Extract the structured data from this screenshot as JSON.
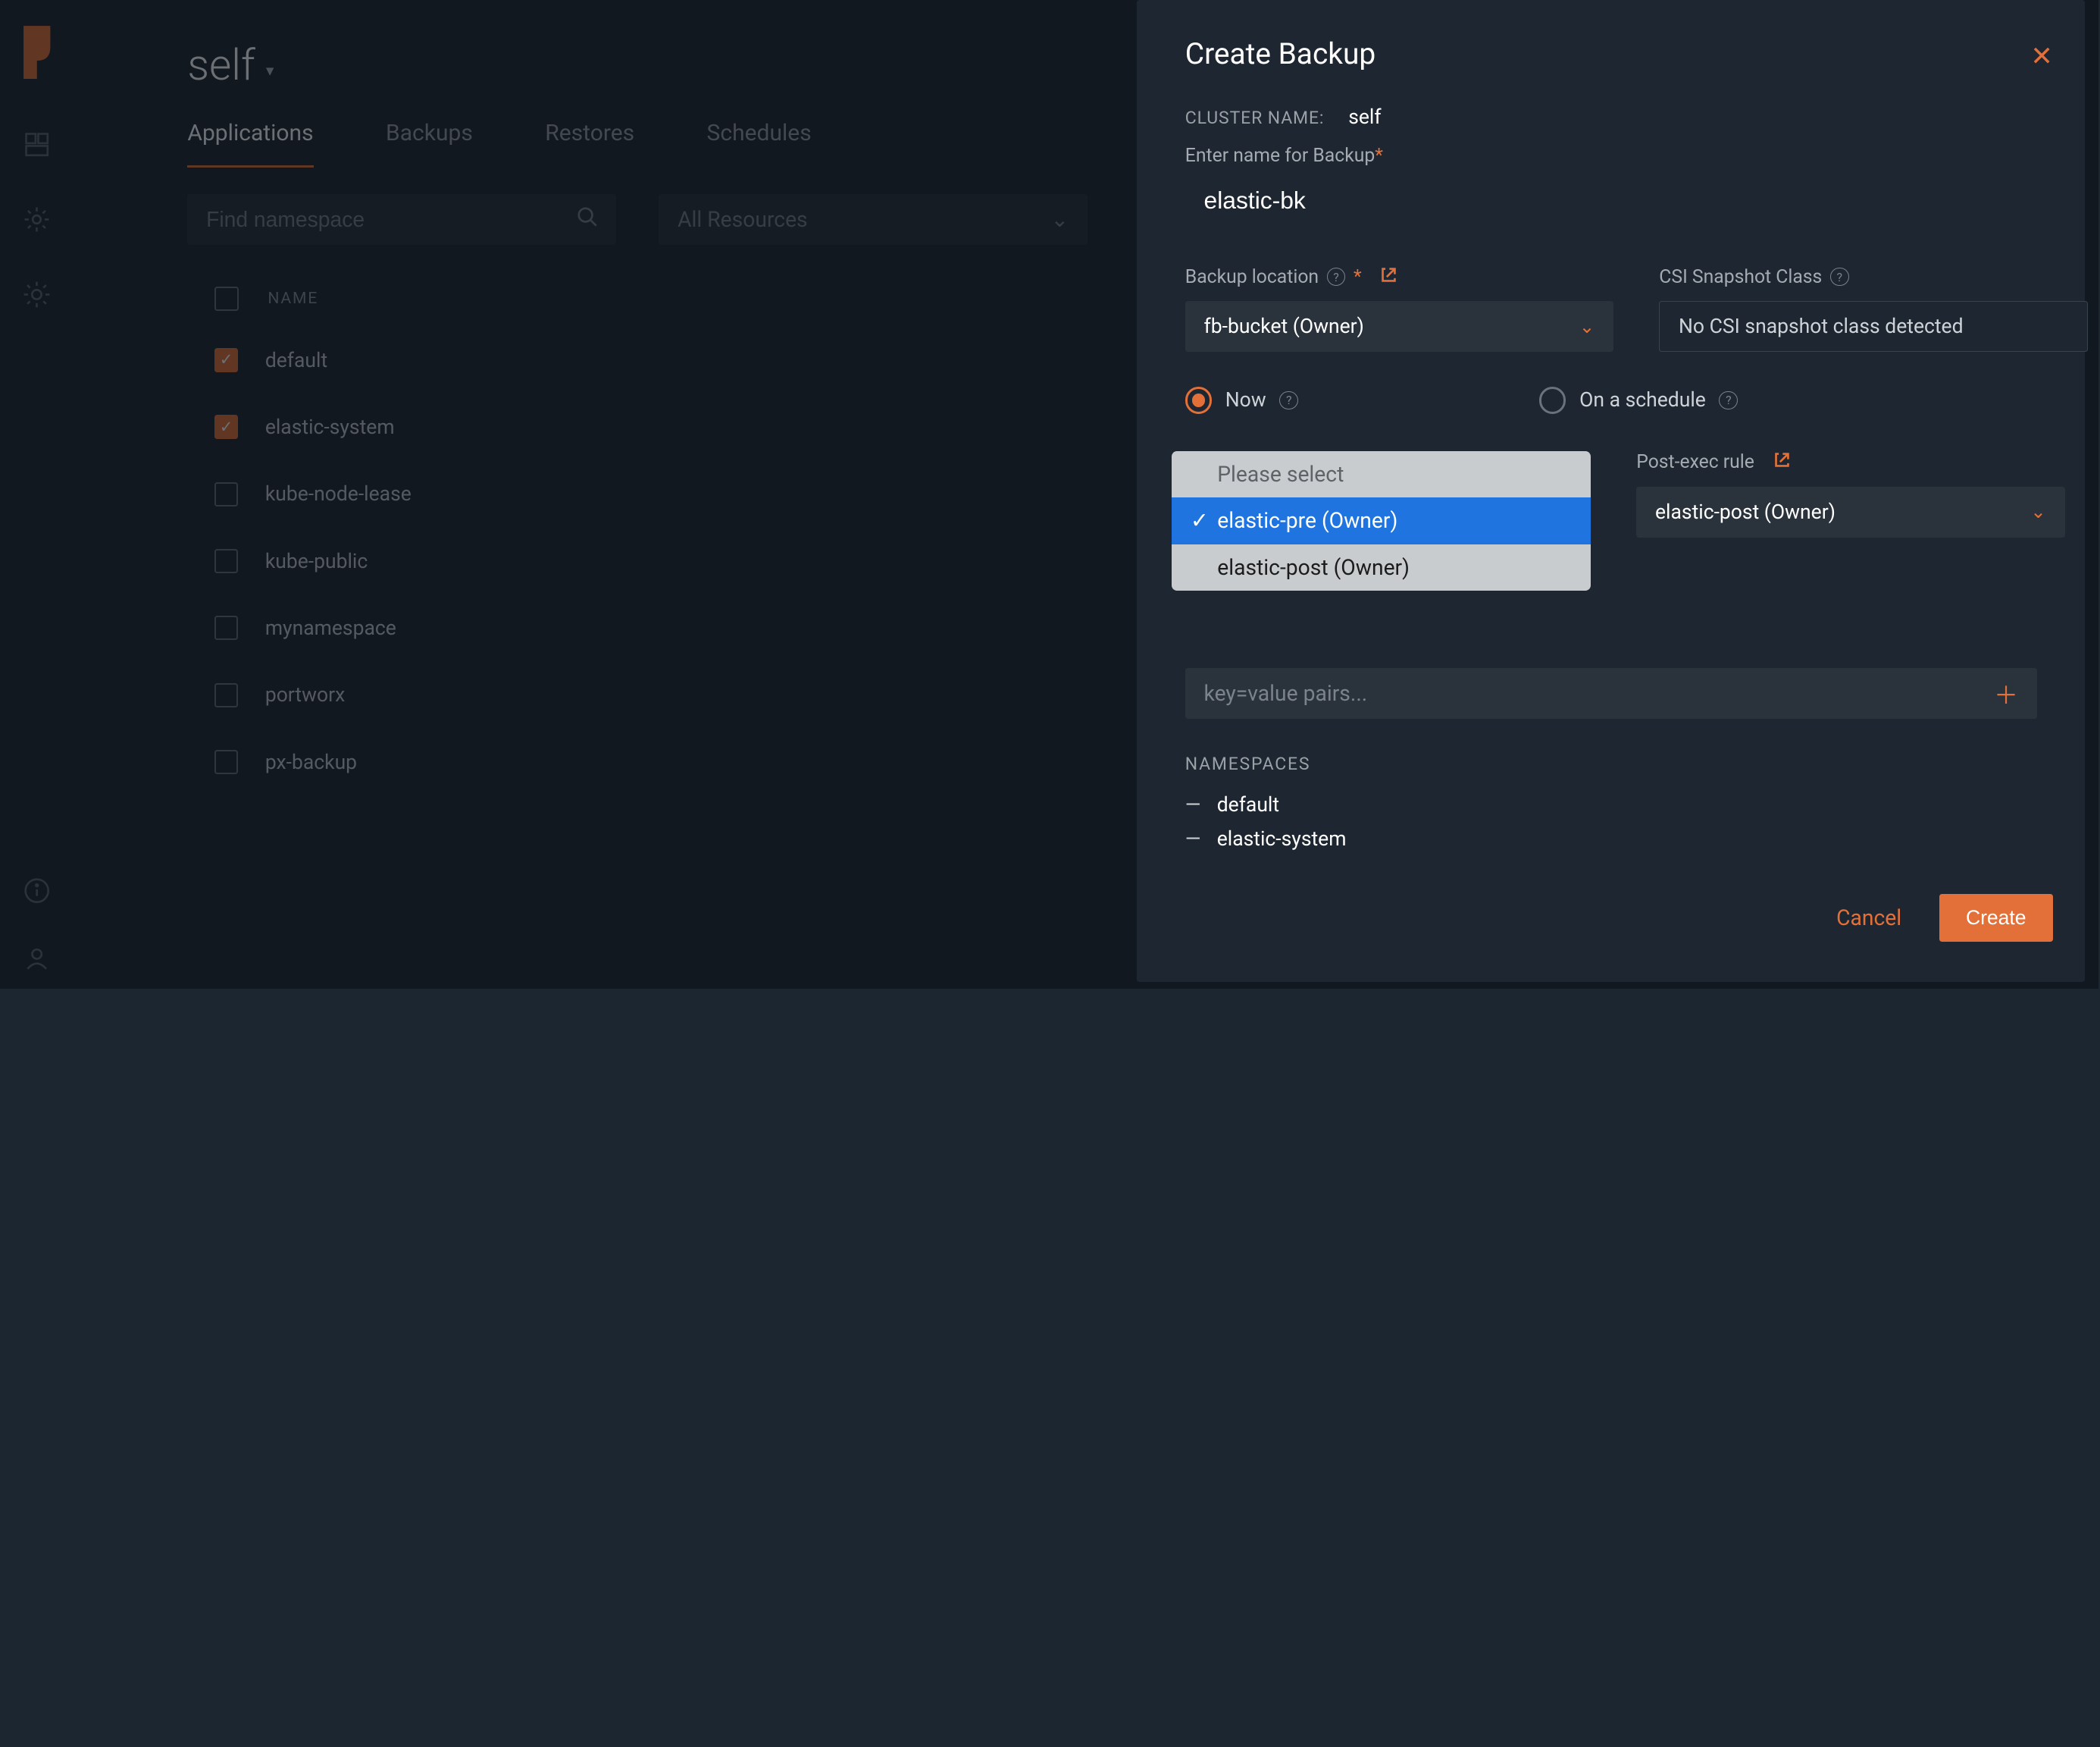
{
  "page": {
    "title": "self"
  },
  "tabs": [
    "Applications",
    "Backups",
    "Restores",
    "Schedules"
  ],
  "activeTab": 0,
  "filters": {
    "ns_placeholder": "Find namespace",
    "res_label": "All Resources"
  },
  "table": {
    "header": "NAME",
    "rows": [
      {
        "name": "default",
        "checked": true
      },
      {
        "name": "elastic-system",
        "checked": true
      },
      {
        "name": "kube-node-lease",
        "checked": false
      },
      {
        "name": "kube-public",
        "checked": false
      },
      {
        "name": "mynamespace",
        "checked": false
      },
      {
        "name": "portworx",
        "checked": false
      },
      {
        "name": "px-backup",
        "checked": false
      }
    ]
  },
  "modal": {
    "title": "Create Backup",
    "cluster_label": "CLUSTER NAME:",
    "cluster_value": "self",
    "enter_name_label": "Enter name for Backup",
    "backup_name": "elastic-bk",
    "location_label": "Backup location",
    "location_value": "fb-bucket (Owner)",
    "csi_label": "CSI Snapshot Class",
    "csi_value": "No CSI snapshot class detected",
    "radio_now": "Now",
    "radio_schedule": "On a schedule",
    "pre_rule_dropdown": {
      "placeholder": "Please select",
      "options": [
        {
          "label": "elastic-pre (Owner)",
          "selected": true
        },
        {
          "label": "elastic-post (Owner)",
          "selected": false
        }
      ]
    },
    "post_rule_label": "Post-exec rule",
    "post_rule_value": "elastic-post (Owner)",
    "kv_placeholder": "key=value pairs...",
    "ns_header": "NAMESPACES",
    "ns_items": [
      "default",
      "elastic-system"
    ],
    "cancel": "Cancel",
    "create": "Create"
  }
}
